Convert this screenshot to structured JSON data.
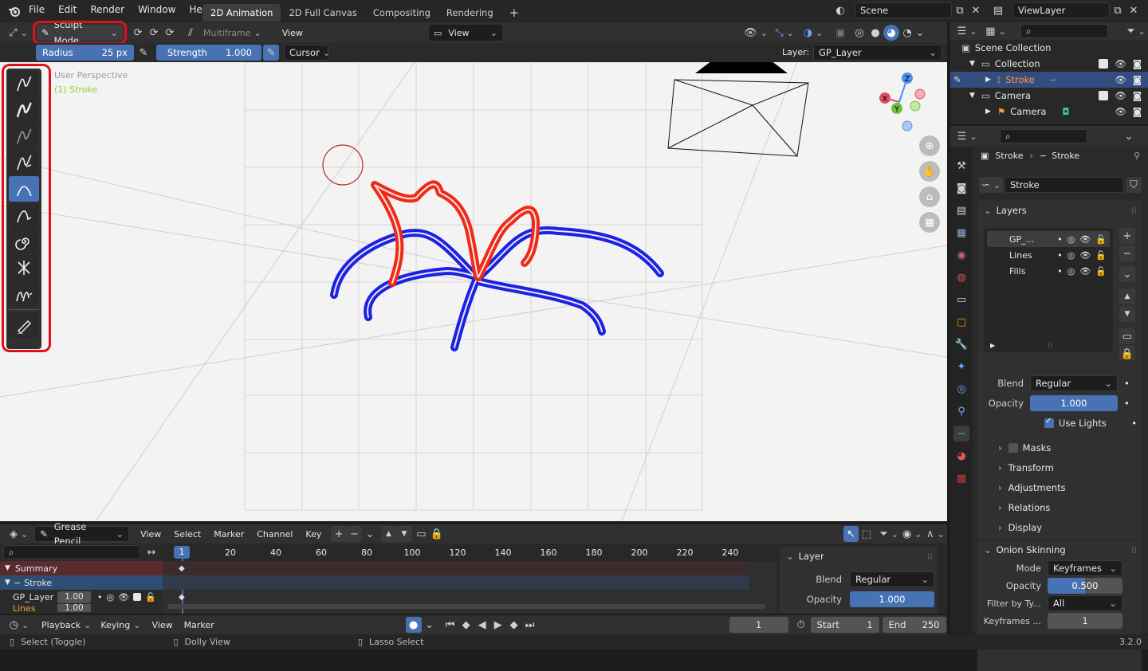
{
  "topbar": {
    "menus": [
      "File",
      "Edit",
      "Render",
      "Window",
      "Help"
    ],
    "workspaces": [
      "2D Animation",
      "2D Full Canvas",
      "Compositing",
      "Rendering"
    ],
    "active_workspace": "2D Animation",
    "add_workspace": "+",
    "scene": "Scene",
    "view_layer": "ViewLayer"
  },
  "viewport_header": {
    "mode": "Sculpt Mode",
    "multiframe": "Multiframe",
    "view_menu": "View",
    "orientation": "View"
  },
  "tool_settings": {
    "radius_label": "Radius",
    "radius_value": "25 px",
    "strength_label": "Strength",
    "strength_value": "1.000",
    "cursor": "Cursor",
    "layer_label": "Layer:",
    "layer_value": "GP_Layer"
  },
  "viewport": {
    "perspective": "User Perspective",
    "object": "(1) Stroke",
    "gizmo_axes": [
      "X",
      "Y",
      "Z"
    ]
  },
  "outliner": {
    "search_placeholder": "",
    "scene_collection": "Scene Collection",
    "items": [
      {
        "label": "Collection",
        "depth": 1,
        "icon": "collection-icon"
      },
      {
        "label": "Stroke",
        "depth": 2,
        "icon": "grease-pencil-icon",
        "selected": true
      },
      {
        "label": "Camera",
        "depth": 1,
        "icon": "collection-icon"
      },
      {
        "label": "Camera",
        "depth": 2,
        "icon": "camera-icon"
      }
    ]
  },
  "properties": {
    "breadcrumb_object": "Stroke",
    "breadcrumb_data": "Stroke",
    "data_name": "Stroke",
    "layers_panel": "Layers",
    "layers": [
      "GP_...",
      "Lines",
      "Fills"
    ],
    "blend_label": "Blend",
    "blend_value": "Regular",
    "opacity_label": "Opacity",
    "opacity_value": "1.000",
    "use_lights": "Use Lights",
    "subpanels": [
      "Masks",
      "Transform",
      "Adjustments",
      "Relations",
      "Display"
    ],
    "onion_panel": "Onion Skinning",
    "mode_label": "Mode",
    "mode_value": "Keyframes",
    "onion_opacity_label": "Opacity",
    "onion_opacity_value": "0.500",
    "filter_label": "Filter by Ty...",
    "filter_value": "All",
    "keyframes_label": "Keyframes ...",
    "keyframes_value": "1"
  },
  "timeline": {
    "editor_mode": "Grease Pencil",
    "menus": [
      "View",
      "Select",
      "Marker",
      "Channel",
      "Key"
    ],
    "frame_numbers": [
      "20",
      "40",
      "60",
      "80",
      "100",
      "120",
      "140",
      "160",
      "180",
      "200",
      "220",
      "240"
    ],
    "current_frame_marker": "1",
    "channels": [
      {
        "label": "Summary"
      },
      {
        "label": "Stroke"
      },
      {
        "label": "GP_Layer",
        "value": "1.00"
      },
      {
        "label": "Lines",
        "value": "1.00"
      }
    ],
    "side_panel": {
      "title": "Layer",
      "blend_label": "Blend",
      "blend_value": "Regular",
      "opacity_label": "Opacity",
      "opacity_value": "1.000"
    }
  },
  "playback_bar": {
    "playback": "Playback",
    "keying": "Keying",
    "view": "View",
    "marker": "Marker",
    "current_frame": "1",
    "start_label": "Start",
    "start_value": "1",
    "end_label": "End",
    "end_value": "250"
  },
  "statusbar": {
    "select": "Select (Toggle)",
    "dolly": "Dolly View",
    "lasso": "Lasso Select",
    "version": "3.2.0"
  },
  "colors": {
    "accent": "#4772b3",
    "highlight_ring": "#e0101a",
    "stroke_blue": "#1e22e0",
    "stroke_red": "#f02a17",
    "selected_text": "#ff9a2e"
  }
}
